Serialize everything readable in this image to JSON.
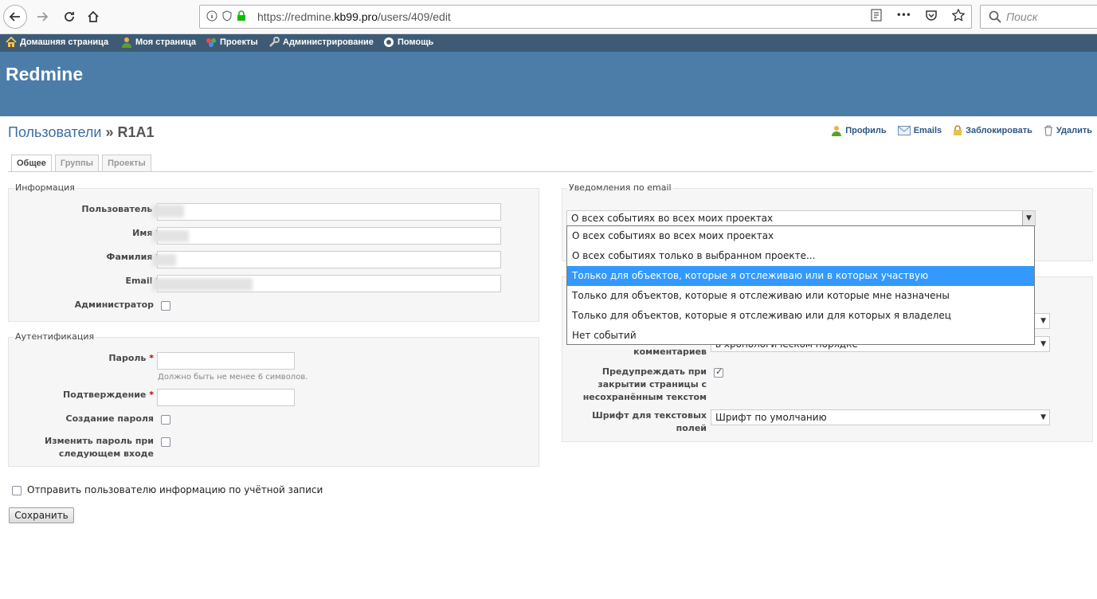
{
  "browser": {
    "url_prefix": "https://redmine.",
    "url_domain": "kb99.pro",
    "url_path": "/users/409/edit",
    "search_placeholder": "Поиск",
    "more_label": "•••"
  },
  "top_menu": {
    "items": [
      "Домашняя страница",
      "Моя страница",
      "Проекты",
      "Администрирование",
      "Помощь"
    ]
  },
  "header": {
    "title": "Redmine"
  },
  "page": {
    "breadcrumb_link": "Пользователи",
    "separator": " » ",
    "current": "R1A1"
  },
  "contextual": {
    "items": [
      "Профиль",
      "Emails",
      "Заблокировать",
      "Удалить"
    ]
  },
  "tabs": [
    "Общее",
    "Группы",
    "Проекты"
  ],
  "info": {
    "legend": "Информация",
    "required_mark": "*",
    "login_label": "Пользователь",
    "firstname_label": "Имя",
    "lastname_label": "Фамилия",
    "email_label": "Email",
    "admin_label": "Администратор"
  },
  "auth": {
    "legend": "Аутентификация",
    "password_label": "Пароль",
    "password_hint": "Должно быть не менее 6 символов.",
    "confirm_label": "Подтверждение",
    "generate_label": "Создание пароля",
    "must_change_line1": "Изменить пароль при",
    "must_change_line2": "следующем входе"
  },
  "notifications": {
    "legend": "Уведомления по email",
    "selected": "О всех событиях во всех моих проектах",
    "options": [
      "О всех событиях во всех моих проектах",
      "О всех событиях только в выбранном проекте...",
      "Только для объектов, которые я отслеживаю или в которых участвую",
      "Только для объектов, которые я отслеживаю или которые мне назначены",
      "Только для объектов, которые я отслеживаю или для которых я владелец",
      "Нет событий"
    ],
    "highlighted_index": 2
  },
  "preferences": {
    "comments_order_label": "комментариев",
    "comments_order_value": "в хронологическом порядке",
    "warn_line1": "Предупреждать при",
    "warn_line2": "закрытии страницы с",
    "warn_line3": "несохранённым текстом",
    "font_line1": "Шрифт для текстовых",
    "font_line2": "полей",
    "font_value": "Шрифт по умолчанию"
  },
  "send_information_label": "Отправить пользователю информацию по учётной записи",
  "save_label": "Сохранить",
  "colors": {
    "top_menu": "#3e5b76",
    "header": "#4b7da8",
    "link": "#3e6ea1",
    "highlight": "#3399ff"
  }
}
